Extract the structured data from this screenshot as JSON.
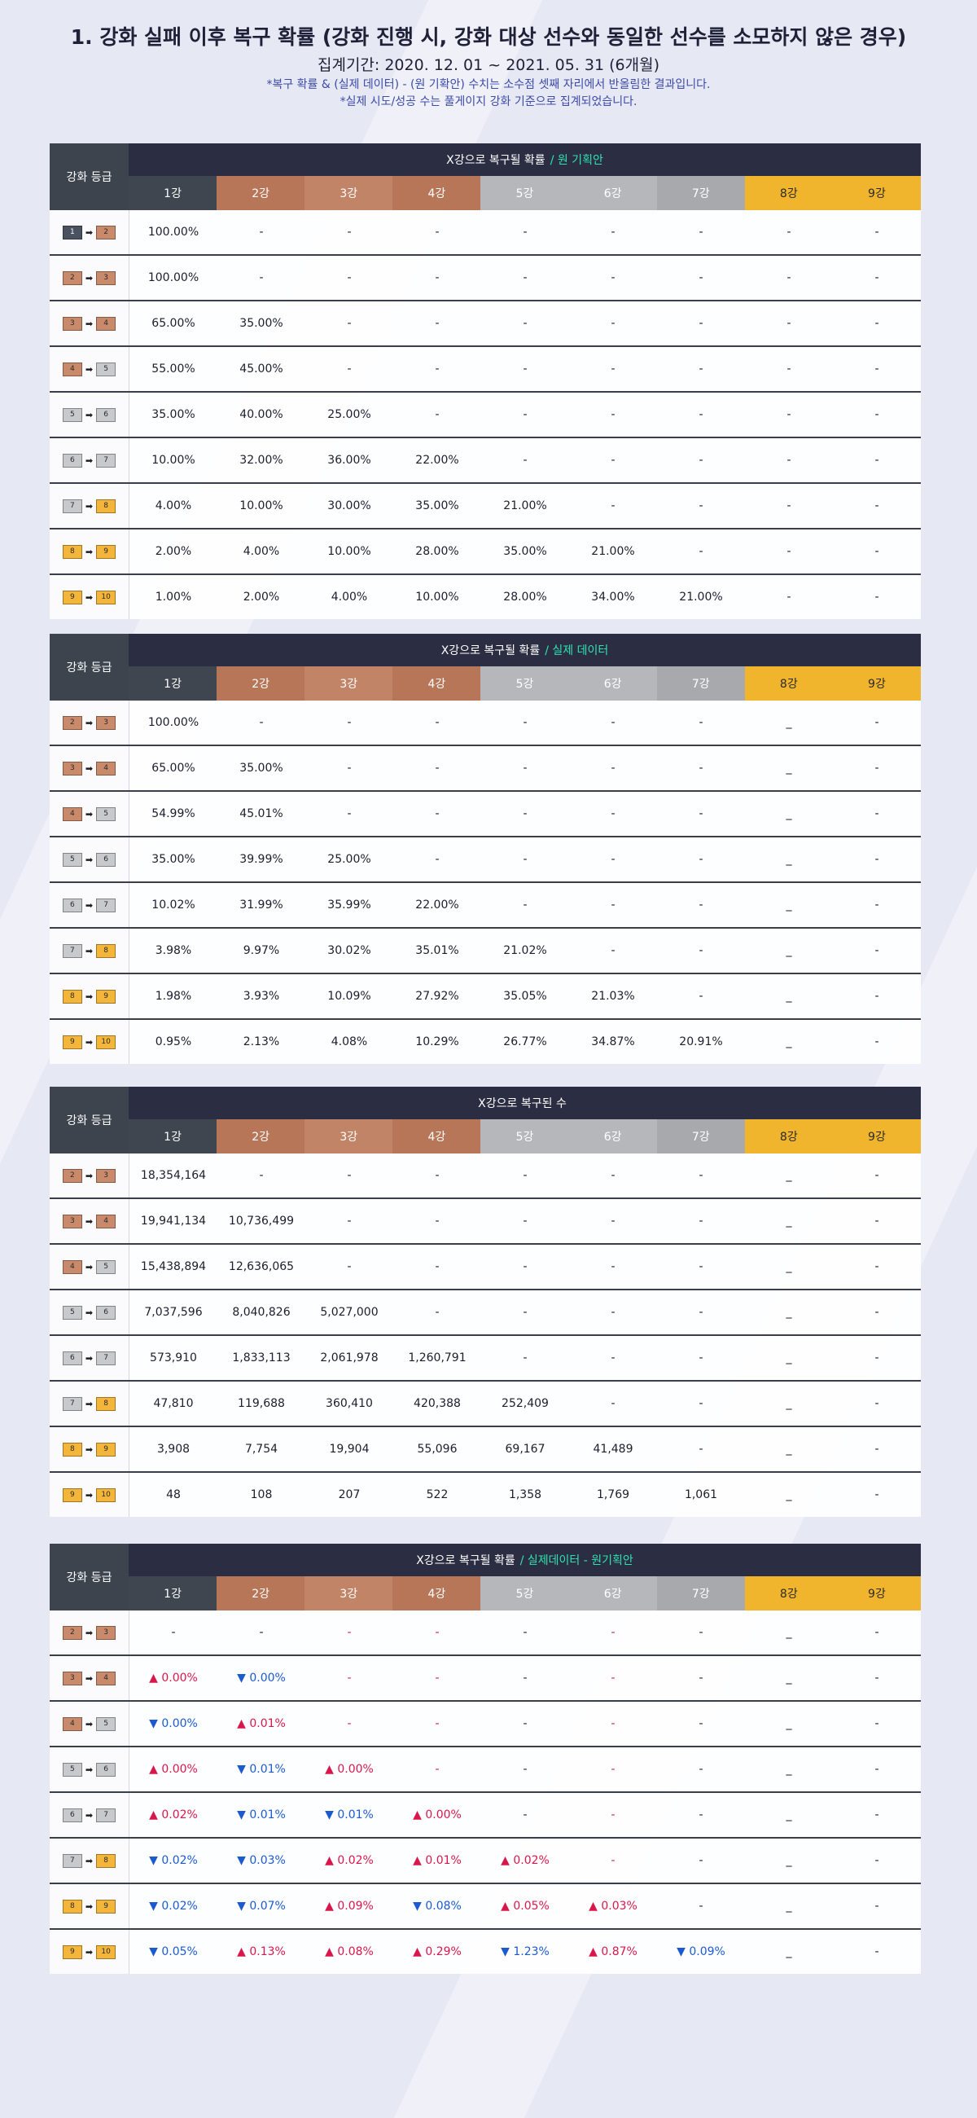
{
  "header": {
    "title": "1. 강화 실패 이후 복구 확률 (강화 진행 시, 강화 대상 선수와 동일한 선수를 소모하지 않은 경우)",
    "period": "집계기간: 2020. 12. 01 ~ 2021. 05. 31 (6개월)",
    "notes": [
      "*복구 확률 & (실제 데이터) - (원 기확안) 수치는 소수점 셋째 자리에서 반올림한 결과입니다.",
      "*실제 시도/성공 수는 풀게이지 강화 기준으로 집계되었습니다."
    ]
  },
  "columns": [
    "1강",
    "2강",
    "3강",
    "4강",
    "5강",
    "6강",
    "7강",
    "8강",
    "9강"
  ],
  "grade_label": "강화 등급",
  "tables": [
    {
      "title": "X강으로 복구될 확률",
      "subtitle": "/ 원 기획안",
      "rows": [
        {
          "from": "1",
          "to": "2",
          "values": [
            "100.00%",
            "-",
            "-",
            "-",
            "-",
            "-",
            "-",
            "-",
            "-"
          ]
        },
        {
          "from": "2",
          "to": "3",
          "values": [
            "100.00%",
            "-",
            "-",
            "-",
            "-",
            "-",
            "-",
            "-",
            "-"
          ]
        },
        {
          "from": "3",
          "to": "4",
          "values": [
            "65.00%",
            "35.00%",
            "-",
            "-",
            "-",
            "-",
            "-",
            "-",
            "-"
          ]
        },
        {
          "from": "4",
          "to": "5",
          "values": [
            "55.00%",
            "45.00%",
            "-",
            "-",
            "-",
            "-",
            "-",
            "-",
            "-"
          ]
        },
        {
          "from": "5",
          "to": "6",
          "values": [
            "35.00%",
            "40.00%",
            "25.00%",
            "-",
            "-",
            "-",
            "-",
            "-",
            "-"
          ]
        },
        {
          "from": "6",
          "to": "7",
          "values": [
            "10.00%",
            "32.00%",
            "36.00%",
            "22.00%",
            "-",
            "-",
            "-",
            "-",
            "-"
          ]
        },
        {
          "from": "7",
          "to": "8",
          "values": [
            "4.00%",
            "10.00%",
            "30.00%",
            "35.00%",
            "21.00%",
            "-",
            "-",
            "-",
            "-"
          ]
        },
        {
          "from": "8",
          "to": "9",
          "values": [
            "2.00%",
            "4.00%",
            "10.00%",
            "28.00%",
            "35.00%",
            "21.00%",
            "-",
            "-",
            "-"
          ]
        },
        {
          "from": "9",
          "to": "10",
          "values": [
            "1.00%",
            "2.00%",
            "4.00%",
            "10.00%",
            "28.00%",
            "34.00%",
            "21.00%",
            "-",
            "-"
          ]
        }
      ]
    },
    {
      "title": "X강으로 복구될 확률",
      "subtitle": "/ 실제 데이터",
      "rows": [
        {
          "from": "2",
          "to": "3",
          "values": [
            "100.00%",
            "-",
            "-",
            "-",
            "-",
            "-",
            "-",
            "_",
            "-"
          ]
        },
        {
          "from": "3",
          "to": "4",
          "values": [
            "65.00%",
            "35.00%",
            "-",
            "-",
            "-",
            "-",
            "-",
            "_",
            "-"
          ]
        },
        {
          "from": "4",
          "to": "5",
          "values": [
            "54.99%",
            "45.01%",
            "-",
            "-",
            "-",
            "-",
            "-",
            "_",
            "-"
          ]
        },
        {
          "from": "5",
          "to": "6",
          "values": [
            "35.00%",
            "39.99%",
            "25.00%",
            "-",
            "-",
            "-",
            "-",
            "_",
            "-"
          ]
        },
        {
          "from": "6",
          "to": "7",
          "values": [
            "10.02%",
            "31.99%",
            "35.99%",
            "22.00%",
            "-",
            "-",
            "-",
            "_",
            "-"
          ]
        },
        {
          "from": "7",
          "to": "8",
          "values": [
            "3.98%",
            "9.97%",
            "30.02%",
            "35.01%",
            "21.02%",
            "-",
            "-",
            "_",
            "-"
          ]
        },
        {
          "from": "8",
          "to": "9",
          "values": [
            "1.98%",
            "3.93%",
            "10.09%",
            "27.92%",
            "35.05%",
            "21.03%",
            "-",
            "_",
            "-"
          ]
        },
        {
          "from": "9",
          "to": "10",
          "values": [
            "0.95%",
            "2.13%",
            "4.08%",
            "10.29%",
            "26.77%",
            "34.87%",
            "20.91%",
            "_",
            "-"
          ]
        }
      ]
    },
    {
      "title": "X강으로 복구된 수",
      "subtitle": "",
      "rows": [
        {
          "from": "2",
          "to": "3",
          "values": [
            "18,354,164",
            "-",
            "-",
            "-",
            "-",
            "-",
            "-",
            "_",
            "-"
          ]
        },
        {
          "from": "3",
          "to": "4",
          "values": [
            "19,941,134",
            "10,736,499",
            "-",
            "-",
            "-",
            "-",
            "-",
            "_",
            "-"
          ]
        },
        {
          "from": "4",
          "to": "5",
          "values": [
            "15,438,894",
            "12,636,065",
            "-",
            "-",
            "-",
            "-",
            "-",
            "_",
            "-"
          ]
        },
        {
          "from": "5",
          "to": "6",
          "values": [
            "7,037,596",
            "8,040,826",
            "5,027,000",
            "-",
            "-",
            "-",
            "-",
            "_",
            "-"
          ]
        },
        {
          "from": "6",
          "to": "7",
          "values": [
            "573,910",
            "1,833,113",
            "2,061,978",
            "1,260,791",
            "-",
            "-",
            "-",
            "_",
            "-"
          ]
        },
        {
          "from": "7",
          "to": "8",
          "values": [
            "47,810",
            "119,688",
            "360,410",
            "420,388",
            "252,409",
            "-",
            "-",
            "_",
            "-"
          ]
        },
        {
          "from": "8",
          "to": "9",
          "values": [
            "3,908",
            "7,754",
            "19,904",
            "55,096",
            "69,167",
            "41,489",
            "-",
            "_",
            "-"
          ]
        },
        {
          "from": "9",
          "to": "10",
          "values": [
            "48",
            "108",
            "207",
            "522",
            "1,358",
            "1,769",
            "1,061",
            "_",
            "-"
          ]
        }
      ]
    },
    {
      "title": "X강으로 복구될 확률",
      "subtitle": "/ 실제데이터 - 원기획안",
      "rows": [
        {
          "from": "2",
          "to": "3",
          "values": [
            "-",
            "-",
            "-",
            "-",
            "-",
            "-",
            "-",
            "_",
            "-"
          ],
          "dirs": [
            "",
            "",
            "r",
            "r",
            "",
            "r",
            "",
            "",
            ""
          ]
        },
        {
          "from": "3",
          "to": "4",
          "values": [
            "▲ 0.00%",
            "▼ 0.00%",
            "-",
            "-",
            "-",
            "-",
            "-",
            "_",
            "-"
          ],
          "dirs": [
            "up",
            "down",
            "r",
            "r",
            "",
            "r",
            "",
            "",
            ""
          ]
        },
        {
          "from": "4",
          "to": "5",
          "values": [
            "▼ 0.00%",
            "▲ 0.01%",
            "-",
            "-",
            "-",
            "-",
            "-",
            "_",
            "-"
          ],
          "dirs": [
            "down",
            "up",
            "r",
            "r",
            "",
            "r",
            "",
            "",
            ""
          ]
        },
        {
          "from": "5",
          "to": "6",
          "values": [
            "▲ 0.00%",
            "▼ 0.01%",
            "▲ 0.00%",
            "-",
            "-",
            "-",
            "-",
            "_",
            "-"
          ],
          "dirs": [
            "up",
            "down",
            "up",
            "r",
            "",
            "r",
            "",
            "",
            ""
          ]
        },
        {
          "from": "6",
          "to": "7",
          "values": [
            "▲ 0.02%",
            "▼ 0.01%",
            "▼ 0.01%",
            "▲ 0.00%",
            "-",
            "-",
            "-",
            "_",
            "-"
          ],
          "dirs": [
            "up",
            "down",
            "down",
            "up",
            "",
            "r",
            "",
            "",
            ""
          ]
        },
        {
          "from": "7",
          "to": "8",
          "values": [
            "▼ 0.02%",
            "▼ 0.03%",
            "▲ 0.02%",
            "▲ 0.01%",
            "▲ 0.02%",
            "-",
            "-",
            "_",
            "-"
          ],
          "dirs": [
            "down",
            "down",
            "up",
            "up",
            "up",
            "r",
            "",
            "",
            ""
          ]
        },
        {
          "from": "8",
          "to": "9",
          "values": [
            "▼ 0.02%",
            "▼ 0.07%",
            "▲ 0.09%",
            "▼ 0.08%",
            "▲ 0.05%",
            "▲ 0.03%",
            "-",
            "_",
            "-"
          ],
          "dirs": [
            "down",
            "down",
            "up",
            "down",
            "up",
            "up",
            "",
            "",
            ""
          ]
        },
        {
          "from": "9",
          "to": "10",
          "values": [
            "▼ 0.05%",
            "▲ 0.13%",
            "▲ 0.08%",
            "▲ 0.29%",
            "▼ 1.23%",
            "▲ 0.87%",
            "▼ 0.09%",
            "_",
            "-"
          ],
          "dirs": [
            "down",
            "up",
            "up",
            "up",
            "down",
            "up",
            "down",
            "",
            ""
          ]
        }
      ]
    }
  ]
}
